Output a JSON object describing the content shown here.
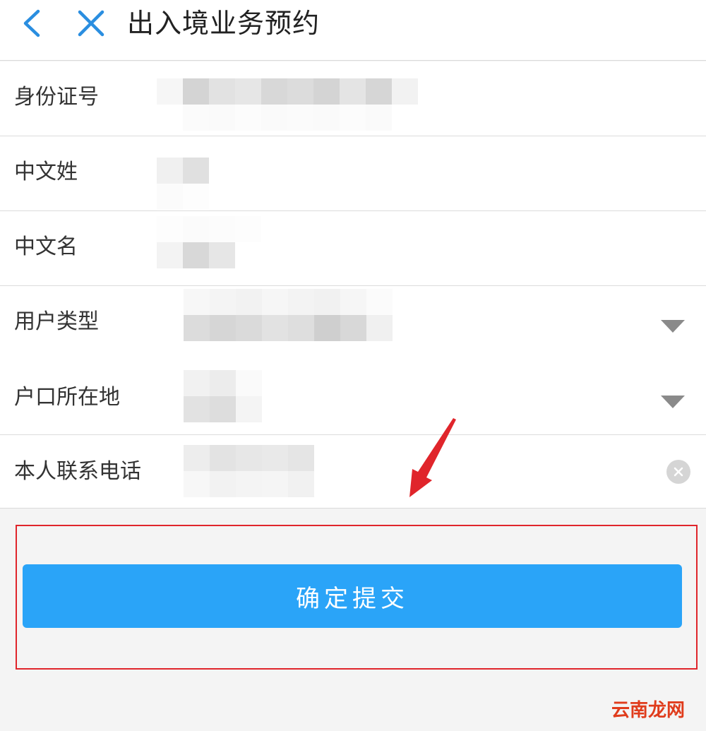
{
  "header": {
    "title": "出入境业务预约",
    "back_icon": "chevron-left-icon",
    "close_icon": "close-icon"
  },
  "form": {
    "fields": [
      {
        "label": "身份证号",
        "value_state": "pixelated"
      },
      {
        "label": "中文姓",
        "value_state": "pixelated"
      },
      {
        "label": "中文名",
        "value_state": "pixelated"
      },
      {
        "label": "用户类型",
        "value_state": "pixelated",
        "control": "dropdown"
      },
      {
        "label": "户口所在地",
        "value_state": "pixelated",
        "control": "dropdown"
      },
      {
        "label": "本人联系电话",
        "value_state": "pixelated",
        "control": "clearable"
      }
    ]
  },
  "submit": {
    "label": "确定提交"
  },
  "watermark": {
    "text": "云南龙网"
  },
  "colors": {
    "accent_blue": "#2aa4f8",
    "icon_blue": "#2a8ee0",
    "highlight_red": "#e0252b"
  }
}
